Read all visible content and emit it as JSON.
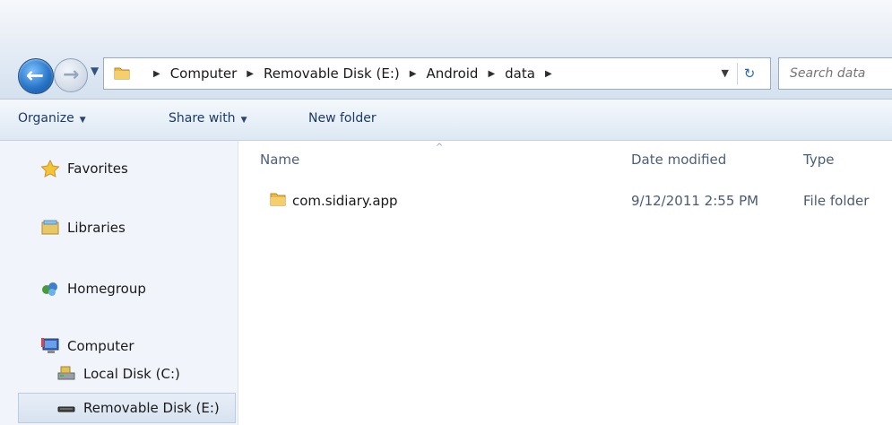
{
  "address": {
    "crumbs": [
      "Computer",
      "Removable Disk (E:)",
      "Android",
      "data"
    ]
  },
  "search": {
    "placeholder": "Search data"
  },
  "toolbar": {
    "organize": "Organize",
    "share_with": "Share with",
    "new_folder": "New folder"
  },
  "nav": {
    "favorites": "Favorites",
    "libraries": "Libraries",
    "homegroup": "Homegroup",
    "computer": "Computer",
    "local_disk": "Local Disk (C:)",
    "removable_disk": "Removable Disk (E:)"
  },
  "columns": {
    "name": "Name",
    "date": "Date modified",
    "type": "Type"
  },
  "files": [
    {
      "name": "com.sidiary.app",
      "date": "9/12/2011 2:55 PM",
      "type": "File folder"
    }
  ],
  "colors": {
    "accent": "#2a76c7",
    "folder": "#e8b84a"
  }
}
